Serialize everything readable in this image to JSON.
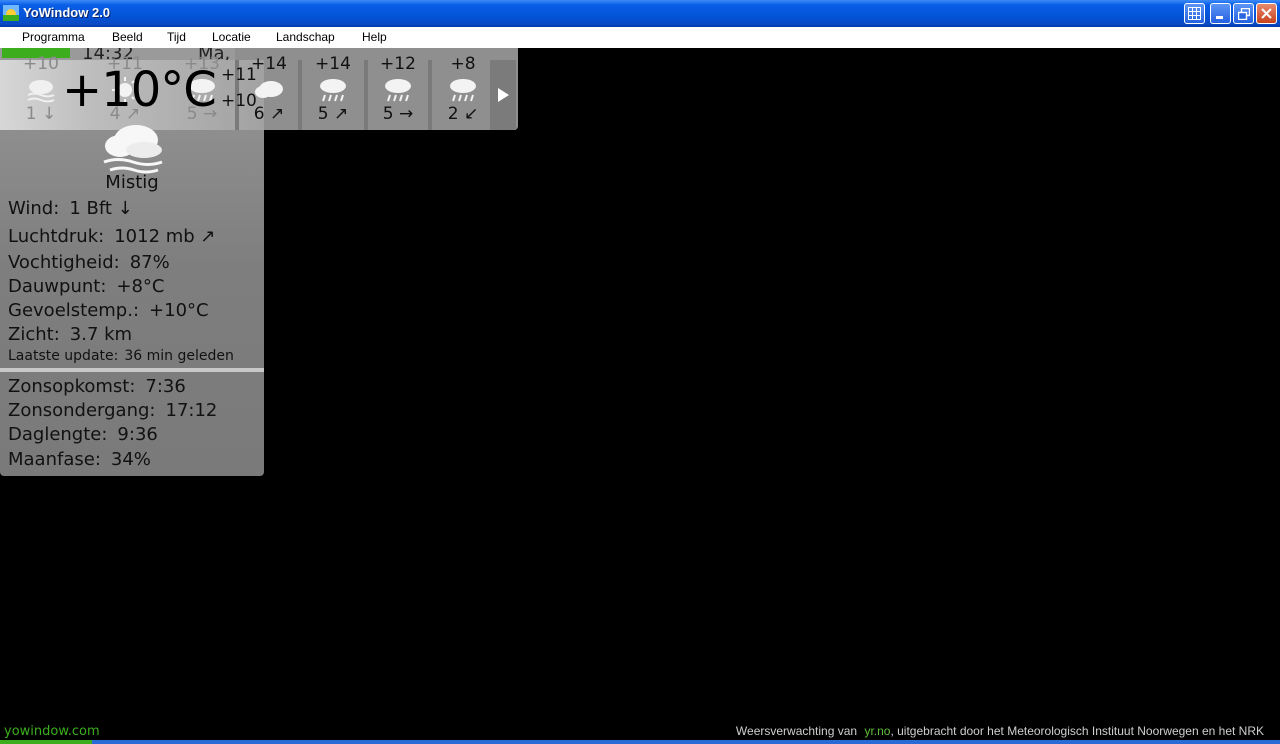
{
  "window": {
    "title": "YoWindow 2.0",
    "controls": [
      "resize-icon",
      "minimize-icon",
      "restore-icon",
      "close-icon"
    ]
  },
  "menu": [
    "Programma",
    "Beeld",
    "Tijd",
    "Locatie",
    "Landschap",
    "Help"
  ],
  "strip": {
    "time": "14:32",
    "date": "Ma, Nov 1"
  },
  "current": {
    "temperature": "+10°C",
    "condition": "Mistig",
    "high": "+11",
    "low": "+10",
    "icon": "fog-icon"
  },
  "forecast": [
    {
      "temp": "+10",
      "wind": "1 ↓",
      "icon": "fog-icon",
      "dim": true
    },
    {
      "temp": "+11",
      "wind": "4 ↗",
      "icon": "sun-icon",
      "dim": true
    },
    {
      "temp": "+13",
      "wind": "5 →",
      "icon": "rain-icon",
      "dim": true
    },
    {
      "temp": "+14",
      "wind": "6 ↗",
      "icon": "cloud-icon",
      "dim": false
    },
    {
      "temp": "+14",
      "wind": "5 ↗",
      "icon": "rain-icon",
      "dim": false
    },
    {
      "temp": "+12",
      "wind": "5 →",
      "icon": "rain-icon",
      "dim": false
    },
    {
      "temp": "+8",
      "wind": "2 ↙",
      "icon": "rain-icon",
      "dim": false
    }
  ],
  "details": [
    {
      "label": "Wind:",
      "value": "1 Bft ↓"
    },
    {
      "label": "Luchtdruk:",
      "value": "1012 mb ↗"
    },
    {
      "label": "Vochtigheid:",
      "value": "87%"
    },
    {
      "label": "Dauwpunt:",
      "value": "+8°C"
    },
    {
      "label": "Gevoelstemp.:",
      "value": "+10°C"
    },
    {
      "label": "Zicht:",
      "value": "3.7 km"
    }
  ],
  "update": {
    "label": "Laatste update:",
    "value": "36 min geleden"
  },
  "sun": [
    {
      "label": "Zonsopkomst:",
      "value": "7:36"
    },
    {
      "label": "Zonsondergang:",
      "value": "17:12"
    },
    {
      "label": "Daglengte:",
      "value": "9:36"
    },
    {
      "label": "Maanfase:",
      "value": "34%"
    }
  ],
  "footer": {
    "site": "yowindow.com",
    "credit_prefix": "Weersverwachting van",
    "credit_link": "yr.no",
    "credit_suffix": ", uitgebracht door het Meteorologisch Instituut Noorwegen en het NRK"
  },
  "colors": {
    "accent_green": "#3cae1e",
    "titlebar_blue": "#0453d8"
  }
}
